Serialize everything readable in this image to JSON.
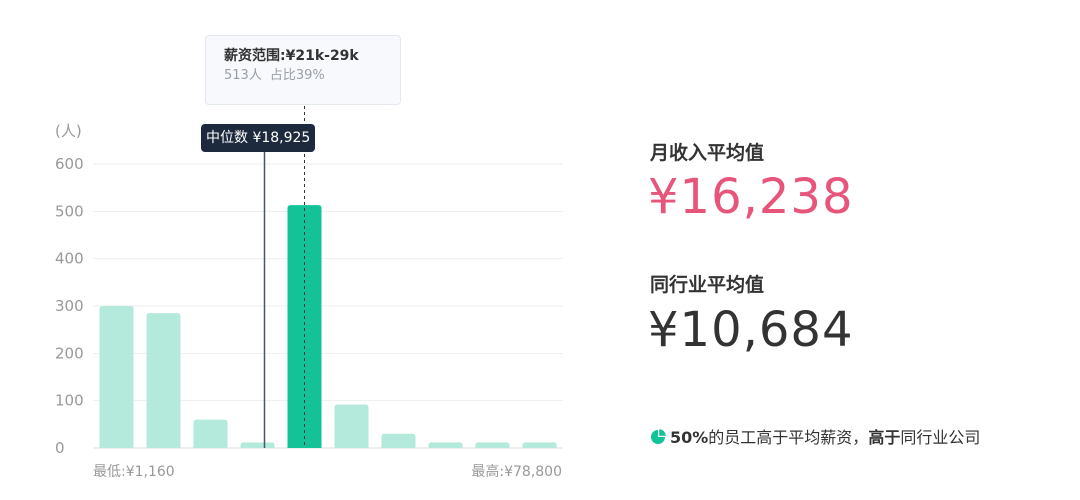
{
  "chart_data": {
    "type": "bar",
    "y_unit_label": "(人)",
    "ylim": [
      0,
      600
    ],
    "y_ticks": [
      0,
      100,
      200,
      300,
      400,
      500,
      600
    ],
    "values": [
      300,
      285,
      60,
      12,
      513,
      92,
      30,
      12,
      12,
      12
    ],
    "highlight_index": 4,
    "x_min_label": "最低:¥1,160",
    "x_max_label": "最高:¥78,800",
    "grid": true,
    "colors": {
      "bar": "#b3eadc",
      "highlight": "#13c397",
      "grid": "#eeeeee",
      "axis_text": "#999999",
      "median_line": "#4a5568"
    },
    "tooltip": {
      "title": "薪资范围:¥21k-29k",
      "count": "513人",
      "share": "占比39%"
    },
    "median_label": "中位数 ¥18,925"
  },
  "stats": {
    "monthly_avg_label": "月收入平均值",
    "monthly_avg_value": "¥16,238",
    "monthly_avg_color": "#e8557a",
    "industry_avg_label": "同行业平均值",
    "industry_avg_value": "¥10,684",
    "industry_avg_color": "#333333"
  },
  "summary": {
    "icon": "pie-chart-icon",
    "icon_color": "#13c397",
    "percent": "50%",
    "text1": "的员工高于平均薪资，",
    "strong": "高于",
    "text2": "同行业公司"
  }
}
